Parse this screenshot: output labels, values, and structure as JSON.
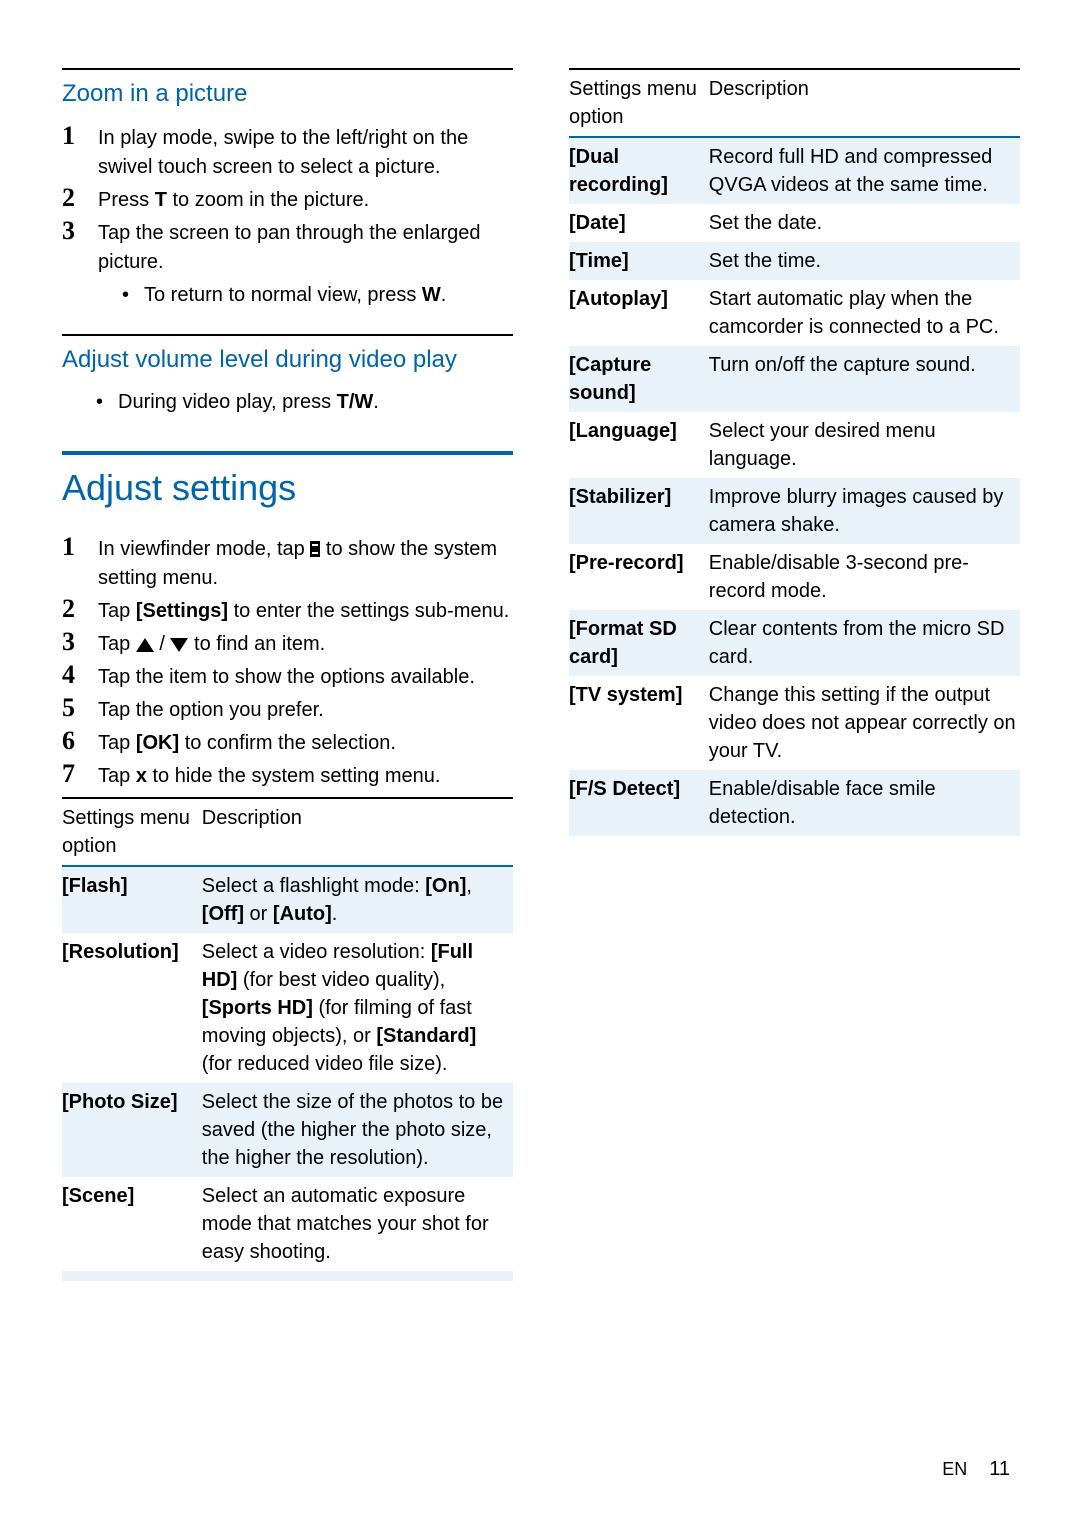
{
  "left": {
    "zoom_heading": "Zoom in a picture",
    "zoom_steps": [
      "In play mode, swipe to the left/right on the swivel touch screen to select a picture.",
      "Press <b>T</b> to zoom in the picture.",
      "Tap the screen to pan through the enlarged picture."
    ],
    "zoom_sub_bullet": "To return to normal view, press <b>W</b>.",
    "volume_heading": "Adjust volume level during video play",
    "volume_bullet": "During video play, press <b>T/W</b>.",
    "adjust_heading": "Adjust settings",
    "adjust_steps": [
      "In viewfinder mode, tap {MENU} to show the system setting menu.",
      "Tap <b>[Settings]</b> to enter the settings sub-menu.",
      "Tap {UP} / {DOWN} to find an item.",
      "Tap the item to show the options available.",
      "Tap the option you prefer.",
      "Tap <b>[OK]</b> to confirm the selection.",
      "Tap <b>x</b> to hide the system setting menu."
    ],
    "table_header": {
      "c1": "Settings menu option",
      "c2": "Description"
    },
    "table_rows": [
      {
        "opt": "[Flash]",
        "desc": "Select a flashlight mode: <b>[On]</b>, <b>[Off]</b> or <b>[Auto]</b>."
      },
      {
        "opt": "[Resolution]",
        "desc": "Select a video resolution: <b>[Full HD]</b> (for best video quality), <b>[Sports HD]</b> (for filming of fast moving objects), or <b>[Standard]</b> (for reduced video file size)."
      },
      {
        "opt": "[Photo Size]",
        "desc": "Select the size of the photos to be saved (the higher the photo size, the higher the resolution)."
      },
      {
        "opt": "[Scene]",
        "desc": "Select an automatic exposure mode that matches your shot for easy shooting."
      }
    ]
  },
  "right": {
    "table_header": {
      "c1": "Settings menu option",
      "c2": "Description"
    },
    "table_rows": [
      {
        "opt": "[Dual recording]",
        "desc": "Record full HD and compressed QVGA videos at the same time."
      },
      {
        "opt": "[Date]",
        "desc": "Set the date."
      },
      {
        "opt": "[Time]",
        "desc": "Set the time."
      },
      {
        "opt": "[Autoplay]",
        "desc": "Start automatic play when the camcorder is connected to a PC."
      },
      {
        "opt": "[Capture sound]",
        "desc": "Turn on/off the capture sound."
      },
      {
        "opt": "[Language]",
        "desc": "Select your desired menu language."
      },
      {
        "opt": "[Stabilizer]",
        "desc": "Improve blurry images caused by camera shake."
      },
      {
        "opt": "[Pre-record]",
        "desc": "Enable/disable 3-second pre-record mode."
      },
      {
        "opt": "[Format SD card]",
        "desc": "Clear contents from the micro SD card."
      },
      {
        "opt": "[TV system]",
        "desc": "Change this setting if the output video does not appear correctly on your TV."
      },
      {
        "opt": "[F/S Detect]",
        "desc": "Enable/disable face smile detection."
      }
    ]
  },
  "footer": {
    "lang": "EN",
    "page": "11"
  }
}
